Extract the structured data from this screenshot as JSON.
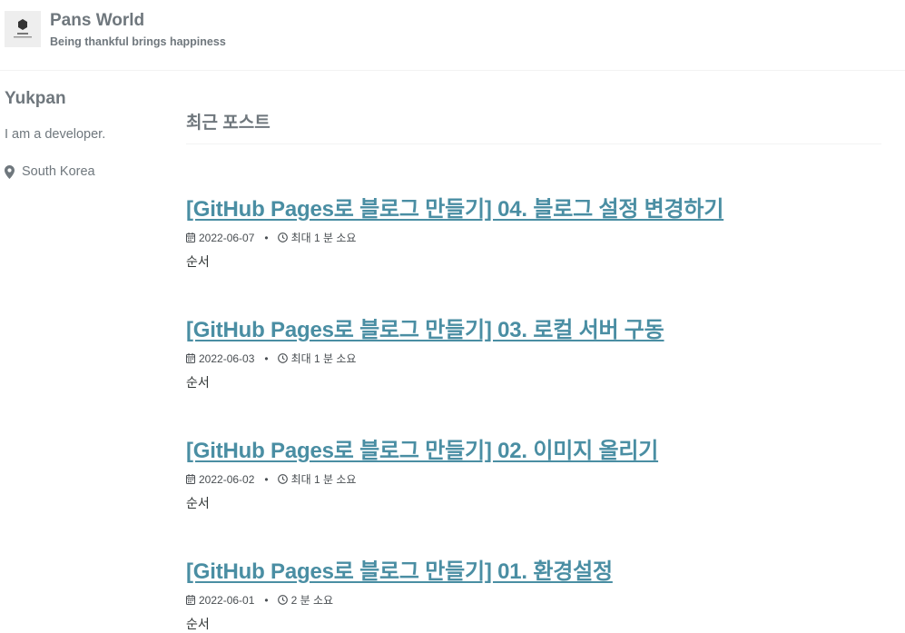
{
  "site": {
    "title": "Pans World",
    "subtitle": "Being thankful brings happiness",
    "logo_text": "Pans World"
  },
  "author": {
    "name": "Yukpan",
    "bio": "I am a developer.",
    "location": "South Korea",
    "location_icon": "map-marker-icon"
  },
  "main": {
    "section_title": "최근 포스트"
  },
  "posts": [
    {
      "title": "[GitHub Pages로 블로그 만들기] 04. 블로그 설정 변경하기",
      "date": "2022-06-07",
      "read_time": "최대 1 분 소요",
      "excerpt": "순서"
    },
    {
      "title": "[GitHub Pages로 블로그 만들기] 03. 로컬 서버 구동",
      "date": "2022-06-03",
      "read_time": "최대 1 분 소요",
      "excerpt": "순서"
    },
    {
      "title": "[GitHub Pages로 블로그 만들기] 02. 이미지 올리기",
      "date": "2022-06-02",
      "read_time": "최대 1 분 소요",
      "excerpt": "순서"
    },
    {
      "title": "[GitHub Pages로 블로그 만들기] 01. 환경설정",
      "date": "2022-06-01",
      "read_time": "2 분 소요",
      "excerpt": "순서"
    }
  ],
  "meta_separator": "•",
  "colors": {
    "link": "#4a8ea3",
    "muted": "#6f777d",
    "text": "#313636"
  }
}
